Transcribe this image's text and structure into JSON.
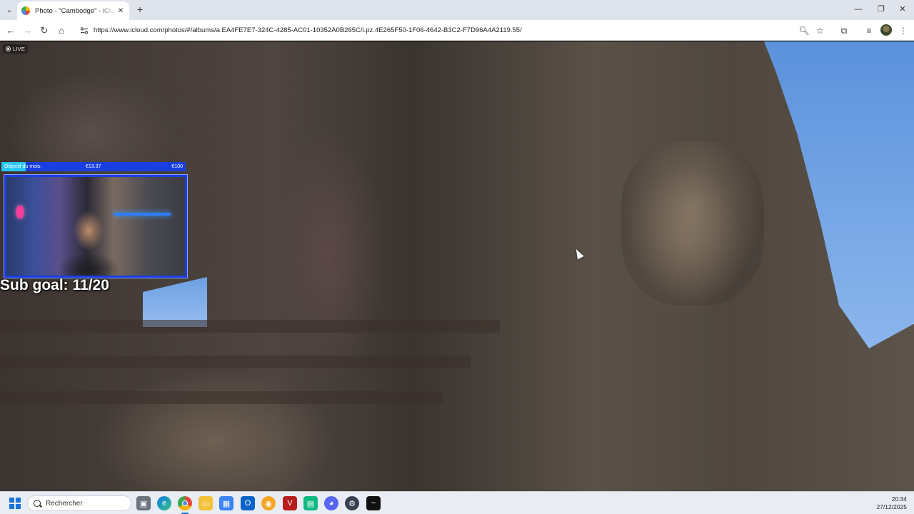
{
  "browser": {
    "tab": {
      "title": "Photo - \"Cambodge\" - iCloud P"
    },
    "url": "https://www.icloud.com/photos/#/albums/a.EA4FE7E7-324C-4285-AC01-10352A0B265C/i.pz.4E265F50-1F06-4642-B3C2-F7D96A4A2119.55/"
  },
  "photo": {
    "live_label": "LIVE"
  },
  "overlay": {
    "goal_label": "Objectif du mois:",
    "goal_current": "€13.37",
    "goal_target": "€100",
    "goal_progress": 0.1337,
    "sub_goal": "Sub goal: 11/20"
  },
  "taskbar": {
    "search_placeholder": "Rechercher",
    "time": "20:34",
    "date": "27/12/2025",
    "apps": [
      "task-view",
      "edge",
      "chrome",
      "file-explorer",
      "microsoft-store",
      "outlook",
      "app-circle",
      "voicemeeter",
      "app-green",
      "discord",
      "steam",
      "terminal"
    ]
  },
  "colors": {
    "overlay_bar": "#1a3fe0",
    "overlay_fill": "#2bc7f2",
    "taskbar_bg": "#e9edf3"
  }
}
